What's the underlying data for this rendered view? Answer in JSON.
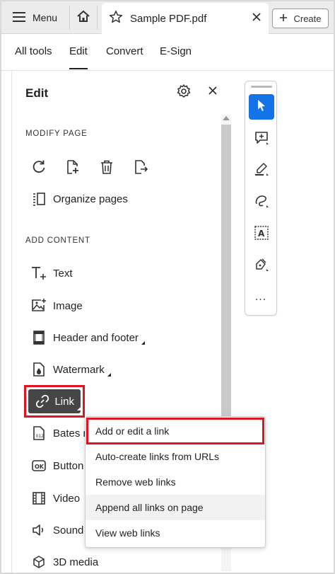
{
  "topbar": {
    "menu_label": "Menu",
    "doc_title": "Sample PDF.pdf",
    "create_label": "Create"
  },
  "nav": {
    "tabs": [
      "All tools",
      "Edit",
      "Convert",
      "E-Sign"
    ],
    "active": "Edit"
  },
  "panel": {
    "title": "Edit",
    "modify_label": "MODIFY PAGE",
    "modify_icons": [
      "rotate-icon",
      "insert-page-icon",
      "delete-icon",
      "extract-page-icon"
    ],
    "organize_label": "Organize pages",
    "add_label": "ADD CONTENT",
    "items": [
      {
        "label": "Text",
        "icon": "text-icon"
      },
      {
        "label": "Image",
        "icon": "image-icon"
      },
      {
        "label": "Header and footer",
        "icon": "header-footer-icon"
      },
      {
        "label": "Watermark",
        "icon": "watermark-icon"
      },
      {
        "label": "Link",
        "icon": "link-icon"
      },
      {
        "label": "Bates n",
        "icon": "bates-icon"
      },
      {
        "label": "Button",
        "icon": "button-icon"
      },
      {
        "label": "Video",
        "icon": "video-icon"
      },
      {
        "label": "Sound",
        "icon": "sound-icon"
      },
      {
        "label": "3D media",
        "icon": "3d-icon"
      }
    ]
  },
  "toolbar": {
    "tools": [
      "select-icon",
      "add-comment-icon",
      "highlight-icon",
      "draw-icon",
      "text-box-icon",
      "sign-icon"
    ],
    "more": "..."
  },
  "link_menu": {
    "items": [
      "Add or edit a link",
      "Auto-create links from URLs",
      "Remove web links",
      "Append all links on page",
      "View web links"
    ]
  },
  "colors": {
    "accent": "#1473e6",
    "highlight": "#e0141e",
    "active_item_bg": "#454545"
  }
}
